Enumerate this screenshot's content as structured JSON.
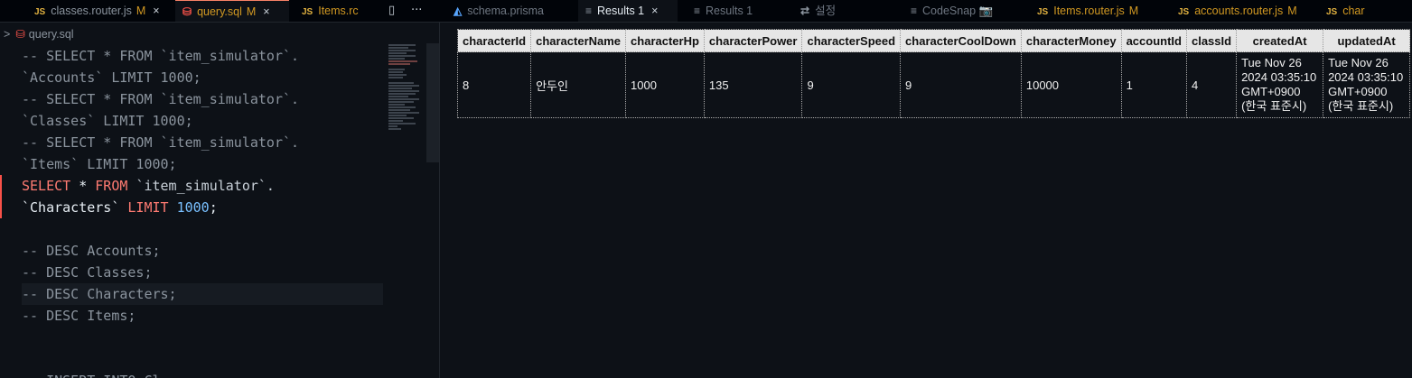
{
  "tabs": [
    {
      "label": "classes.router.js",
      "badge": "M",
      "icon": "JS",
      "close": "×"
    },
    {
      "label": "query.sql",
      "badge": "M",
      "close": "×"
    },
    {
      "label": "Items.rc",
      "icon": "JS"
    },
    {
      "label": "schema.prisma"
    },
    {
      "label": "Results 1",
      "close": "×"
    },
    {
      "label": "Results 1"
    },
    {
      "label": "설정"
    },
    {
      "label": "CodeSnap 📷"
    },
    {
      "label": "Items.router.js",
      "badge": "M",
      "icon": "JS"
    },
    {
      "label": "accounts.router.js",
      "badge": "M",
      "icon": "JS"
    },
    {
      "label": "char",
      "icon": "JS"
    }
  ],
  "toolbar": {
    "split_icon": "▯",
    "more_icon": "···"
  },
  "breadcrumb": {
    "chevron": ">",
    "file": "query.sql"
  },
  "editor": {
    "lines": [
      {
        "a": "-- SELECT * FROM `item_simulator`."
      },
      {
        "a": "`Accounts` LIMIT 1000;"
      },
      {
        "a": "-- SELECT * FROM `item_simulator`."
      },
      {
        "a": "`Classes` LIMIT 1000;"
      },
      {
        "a": "-- SELECT * FROM `item_simulator`."
      },
      {
        "a": "`Items` LIMIT 1000;"
      },
      {
        "kw1": "SELECT",
        "op": " * ",
        "kw2": "FROM",
        "sp": " ",
        "tick": "`item_simulator`."
      },
      {
        "ident": "`Characters`",
        "sp": " ",
        "kw": "LIMIT",
        "sp2": " ",
        "num": "1000",
        "end": ";"
      },
      {
        "a": ""
      },
      {
        "a": "-- DESC Accounts;"
      },
      {
        "a": "-- DESC Classes;"
      },
      {
        "a": "-- DESC Characters;"
      },
      {
        "a": "-- DESC Items;"
      },
      {
        "a": ""
      },
      {
        "a": ""
      },
      {
        "a": "-- INSERT INTO Cl"
      }
    ]
  },
  "results": {
    "columns": [
      "characterId",
      "characterName",
      "characterHp",
      "characterPower",
      "characterSpeed",
      "characterCoolDown",
      "characterMoney",
      "accountId",
      "classId",
      "createdAt",
      "updatedAt"
    ],
    "rows": [
      [
        "8",
        "안두인",
        "1000",
        "135",
        "9",
        "9",
        "10000",
        "1",
        "4",
        "Tue Nov 26 2024 03:35:10 GMT+0900 (한국 표준시)",
        "Tue Nov 26 2024 03:35:10 GMT+0900 (한국 표준시)"
      ]
    ]
  }
}
